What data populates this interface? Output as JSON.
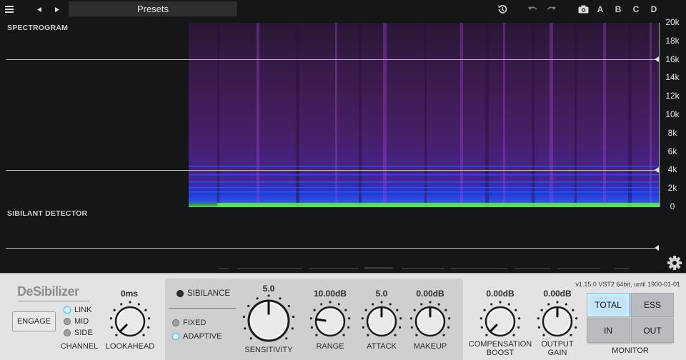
{
  "toolbar": {
    "menu_icon": "hamburger-icon",
    "prev_icon": "triangle-left-icon",
    "next_icon": "triangle-right-icon",
    "preset_label": "Presets",
    "reset_icon": "reset-icon",
    "undo_icon": "undo-icon",
    "redo_icon": "redo-icon",
    "snapshot_icon": "camera-icon",
    "slots": [
      "A",
      "B",
      "C",
      "D"
    ]
  },
  "spectrogram": {
    "title": "SPECTROGRAM",
    "freq_labels": [
      "20k",
      "18k",
      "16k",
      "14k",
      "12k",
      "10k",
      "8k",
      "6k",
      "4k",
      "2k",
      "0"
    ]
  },
  "detector": {
    "title": "SIBILANT DETECTOR"
  },
  "settings_icon": "gear-icon",
  "plugin": {
    "logo": "DeSibilizer",
    "engage_label": "ENGAGE",
    "version": "v1.15.0 VST2 64bit, until 1900-01-01"
  },
  "channel": {
    "label": "CHANNEL",
    "options": [
      {
        "label": "LINK",
        "selected": true
      },
      {
        "label": "MID",
        "selected": false
      },
      {
        "label": "SIDE",
        "selected": false
      }
    ]
  },
  "lookahead": {
    "label": "LOOKAHEAD",
    "value": "0ms",
    "level": 0
  },
  "sibilance": {
    "label": "SIBILANCE",
    "mode_fixed": "FIXED",
    "mode_adaptive": "ADAPTIVE",
    "mode_selected": "ADAPTIVE"
  },
  "sensitivity": {
    "label": "SENSITIVITY",
    "value": "5.0",
    "level": 0.5
  },
  "range": {
    "label": "RANGE",
    "value": "10.00dB",
    "level": 0.2
  },
  "attack": {
    "label": "ATTACK",
    "value": "5.0",
    "level": 0.5
  },
  "makeup": {
    "label": "MAKEUP",
    "value": "0.00dB",
    "level": 0.5
  },
  "compensation_boost": {
    "label_line1": "COMPENSATION",
    "label_line2": "BOOST",
    "value": "0.00dB",
    "level": 0
  },
  "output_gain": {
    "label_line1": "OUTPUT",
    "label_line2": "GAIN",
    "value": "0.00dB",
    "level": 0.5
  },
  "monitor": {
    "label": "MONITOR",
    "buttons": [
      {
        "label": "TOTAL",
        "selected": true
      },
      {
        "label": "ESS",
        "selected": false
      },
      {
        "label": "IN",
        "selected": false
      },
      {
        "label": "OUT",
        "selected": false
      }
    ]
  },
  "colors": {
    "accent": "#6fd0ff",
    "spectrum_low": "#50e65a",
    "spectrum_mid": "#2850ff",
    "spectrum_high": "#6e2896"
  }
}
